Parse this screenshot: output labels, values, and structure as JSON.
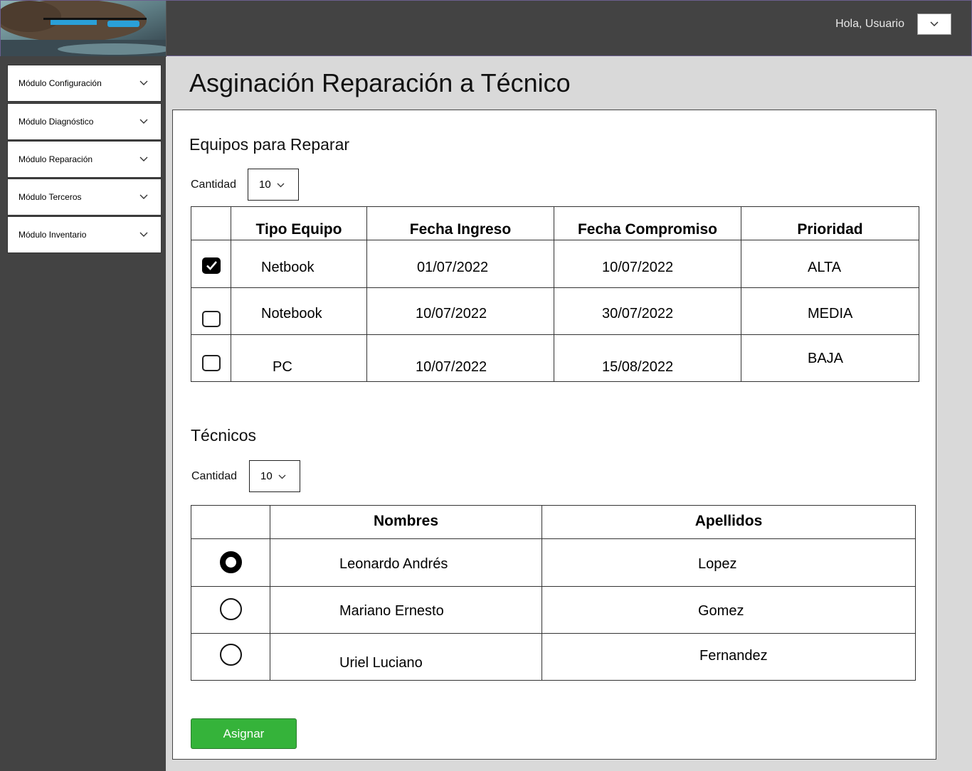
{
  "header": {
    "greeting": "Hola, Usuario",
    "user_menu_icon": "chevron-down-icon"
  },
  "sidebar": {
    "items": [
      {
        "label": "Módulo Configuración"
      },
      {
        "label": "Módulo Diagnóstico"
      },
      {
        "label": "Módulo Reparación"
      },
      {
        "label": "Módulo Terceros"
      },
      {
        "label": "Módulo Inventario"
      }
    ]
  },
  "page": {
    "title": "Asginación Reparación a Técnico"
  },
  "equipos": {
    "title": "Equipos para Reparar",
    "cantidad_label": "Cantidad",
    "cantidad_value": "10",
    "columns": [
      "Tipo Equipo",
      "Fecha Ingreso",
      "Fecha Compromiso",
      "Prioridad"
    ],
    "rows": [
      {
        "checked": true,
        "tipo": "Netbook",
        "ingreso": "01/07/2022",
        "compromiso": "10/07/2022",
        "prioridad": "ALTA"
      },
      {
        "checked": false,
        "tipo": "Notebook",
        "ingreso": "10/07/2022",
        "compromiso": "30/07/2022",
        "prioridad": "MEDIA"
      },
      {
        "checked": false,
        "tipo": "PC",
        "ingreso": "10/07/2022",
        "compromiso": "15/08/2022",
        "prioridad": "BAJA"
      }
    ]
  },
  "tecnicos": {
    "title": "Técnicos",
    "cantidad_label": "Cantidad",
    "cantidad_value": "10",
    "columns": [
      "Nombres",
      "Apellidos"
    ],
    "rows": [
      {
        "selected": true,
        "nombres": "Leonardo Andrés",
        "apellidos": "Lopez"
      },
      {
        "selected": false,
        "nombres": "Mariano Ernesto",
        "apellidos": "Gomez"
      },
      {
        "selected": false,
        "nombres": "Uriel Luciano",
        "apellidos": "Fernandez"
      }
    ]
  },
  "actions": {
    "assign_label": "Asignar",
    "assign_color": "#35b33a"
  }
}
